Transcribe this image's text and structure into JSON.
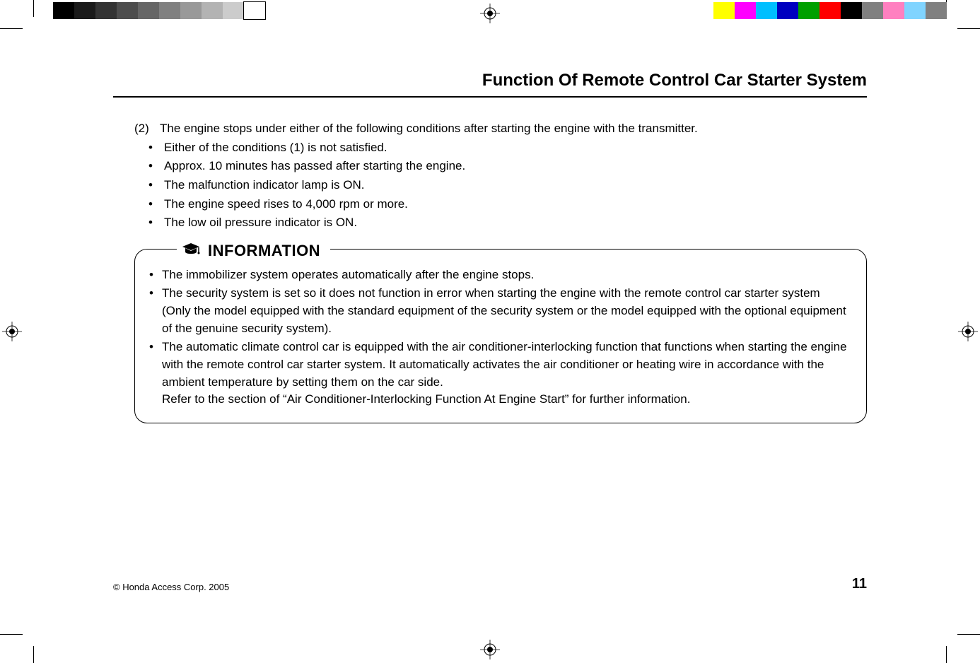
{
  "page": {
    "title": "Function Of Remote Control Car Starter System",
    "section_num": "(2)",
    "section_text": "The engine stops under either of the following conditions after starting the engine with the transmitter.",
    "bullets": [
      "Either of the conditions (1) is not satisfied.",
      "Approx. 10 minutes has passed after starting the engine.",
      "The malfunction indicator lamp is ON.",
      "The engine speed rises to 4,000 rpm or more.",
      "The low oil pressure indicator is ON."
    ],
    "info_label": "INFORMATION",
    "info_items": [
      "The immobilizer system operates automatically after the engine stops.",
      "The security system is set so it does not function in error when starting the engine with the remote control car starter system (Only the model equipped with the standard equipment of the security system or the model equipped with the optional equipment of the genuine security system).",
      "The automatic climate control car is equipped with the air conditioner-interlocking function that functions when starting the engine with the remote control car starter system. It automatically activates the air conditioner or heating wire in accordance with the ambient temperature by setting them on the car side."
    ],
    "info_sub": "Refer to the section of “Air Conditioner-Interlocking Function At Engine Start” for further information.",
    "copyright": "© Honda Access Corp. 2005",
    "page_number": "11"
  },
  "colors": {
    "gray_bar": [
      "#000000",
      "#1a1a1a",
      "#333333",
      "#4d4d4d",
      "#666666",
      "#808080",
      "#999999",
      "#b3b3b3",
      "#cccccc",
      "#ffffff"
    ],
    "color_bar": [
      "#ffff00",
      "#ff00ff",
      "#00bfff",
      "#0000c0",
      "#00a000",
      "#ff0000",
      "#000000",
      "#808080",
      "#ff80c0",
      "#80d4ff",
      "#808080"
    ]
  }
}
